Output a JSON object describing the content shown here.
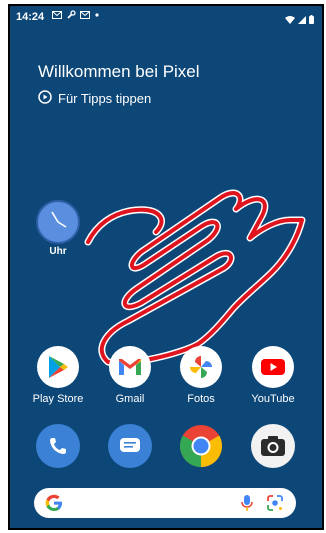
{
  "status_bar": {
    "time": "14:24",
    "left_icons": [
      "gmail-icon",
      "wrench-icon",
      "gmail-icon",
      "dot-icon"
    ],
    "right_icons": [
      "wifi-icon",
      "signal-icon",
      "battery-icon"
    ]
  },
  "welcome": {
    "title": "Willkommen bei Pixel",
    "tips_label": "Für Tipps tippen"
  },
  "clock_widget": {
    "label": "Uhr"
  },
  "apps": [
    {
      "label": "Play Store",
      "icon": "play-store-icon"
    },
    {
      "label": "Gmail",
      "icon": "gmail-icon"
    },
    {
      "label": "Fotos",
      "icon": "photos-icon"
    },
    {
      "label": "YouTube",
      "icon": "youtube-icon"
    }
  ],
  "dock": [
    {
      "icon": "phone-icon"
    },
    {
      "icon": "messages-icon"
    },
    {
      "icon": "chrome-icon"
    },
    {
      "icon": "camera-icon"
    }
  ],
  "search_bar": {
    "icons": [
      "google-g-icon",
      "mic-icon",
      "lens-icon"
    ]
  },
  "colors": {
    "wallpaper": "#0d4778",
    "scribble": "#e0141e"
  }
}
